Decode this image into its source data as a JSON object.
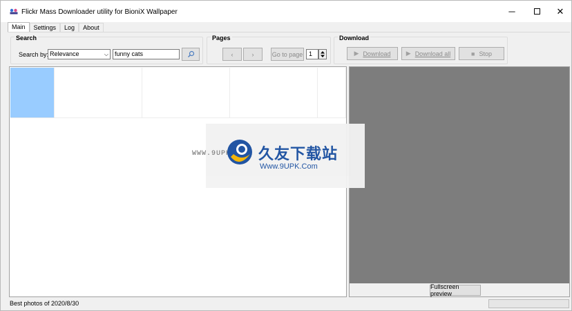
{
  "window": {
    "title": "Flickr Mass Downloader utility for BioniX Wallpaper",
    "controls": {
      "minimize": "─",
      "close": "✕"
    }
  },
  "tabs": [
    {
      "label": "Main",
      "active": true
    },
    {
      "label": "Settings",
      "active": false
    },
    {
      "label": "Log",
      "active": false
    },
    {
      "label": "About",
      "active": false
    }
  ],
  "search": {
    "group_title": "Search",
    "search_by_label": "Search by:",
    "search_by_value": "Relevance",
    "query_value": "funny cats"
  },
  "pages": {
    "group_title": "Pages",
    "prev": "‹",
    "next": "›",
    "go_to_page": "Go to page",
    "page_value": "1"
  },
  "download": {
    "group_title": "Download",
    "download": "Download",
    "download_all": "Download all",
    "stop": "Stop"
  },
  "results": {
    "thumbnails": [
      {
        "selected": true
      },
      {
        "selected": false
      },
      {
        "selected": false
      },
      {
        "selected": false
      },
      {
        "selected": false
      },
      {
        "selected": false
      },
      {
        "selected": false
      },
      {
        "selected": false
      }
    ]
  },
  "preview": {
    "fullscreen_button": "Fullscreen preview"
  },
  "status": {
    "text": "Best photos of 2020/8/30",
    "progress_fraction": 0
  },
  "watermark": {
    "left_text": "WWW.9UPK.COM",
    "cn_text": "久友下载站",
    "url": "Www.9UPK.Com"
  }
}
